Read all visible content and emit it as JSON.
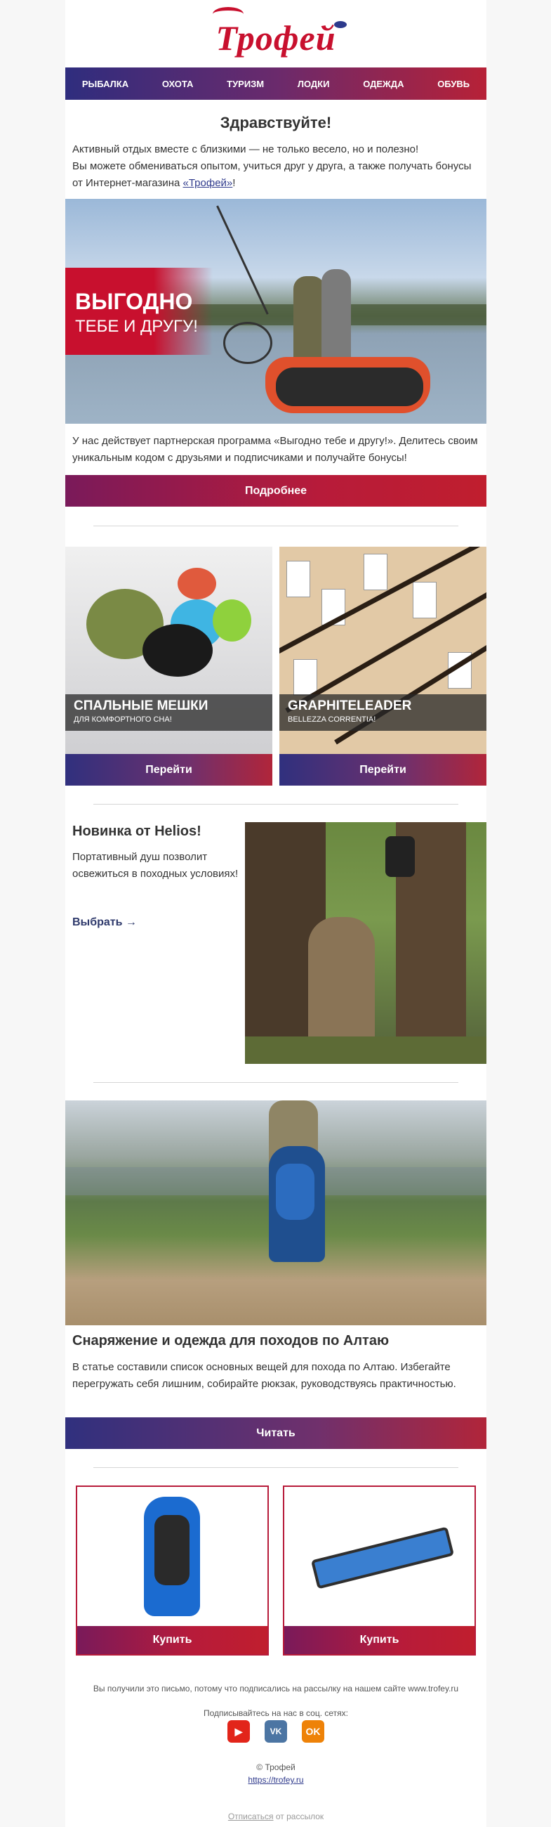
{
  "brand": {
    "name": "Трофей"
  },
  "nav": [
    "РЫБАЛКА",
    "ОХОТА",
    "ТУРИЗМ",
    "ЛОДКИ",
    "ОДЕЖДА",
    "ОБУВЬ"
  ],
  "greeting": "Здравствуйте!",
  "intro": {
    "line1": "Активный отдых вместе с близкими — не только весело, но и полезно!",
    "line2": "Вы можете обмениваться опытом, учиться друг у друга, а также получать бонусы от Интернет-магазина ",
    "link": "«Трофей»",
    "end": "!"
  },
  "hero": {
    "title": "ВЫГОДНО",
    "subtitle": "ТЕБЕ И ДРУГУ!"
  },
  "partner_text": "У нас действует партнерская программа «Выгодно тебе и другу!». Делитесь своим уникальным кодом с друзьями и подписчиками и получайте бонусы!",
  "more_button": "Подробнее",
  "categories": [
    {
      "title": "СПАЛЬНЫЕ МЕШКИ",
      "subtitle": "ДЛЯ КОМФОРТНОГО СНА!",
      "button": "Перейти"
    },
    {
      "title": "GRAPHITELEADER",
      "subtitle": "BELLEZZA CORRENTIA!",
      "button": "Перейти"
    }
  ],
  "helios": {
    "title": "Новинка от Helios!",
    "text": "Портативный душ позволит освежиться в походных условиях!",
    "link": "Выбрать →"
  },
  "article": {
    "title": "Снаряжение и одежда для походов по Алтаю",
    "text": "В статье составили список основных вещей для похода по Алтаю. Избегайте перегружать себя лишним, собирайте рюкзак, руководствуясь практичностью.",
    "button": "Читать"
  },
  "products": [
    {
      "button": "Купить"
    },
    {
      "button": "Купить"
    }
  ],
  "footer": {
    "note": "Вы получили это письмо, потому что подписались на рассылку на нашем сайте www.trofey.ru",
    "social_label": "Подписывайтесь на нас в соц. сетях:",
    "copyright": "© Трофей",
    "site": "https://trofey.ru",
    "unsubscribe": "Отписаться",
    "unsubscribe_tail": " от рассылок"
  },
  "colors": {
    "accent": "#c8102e",
    "navy": "#2f2d7e"
  }
}
